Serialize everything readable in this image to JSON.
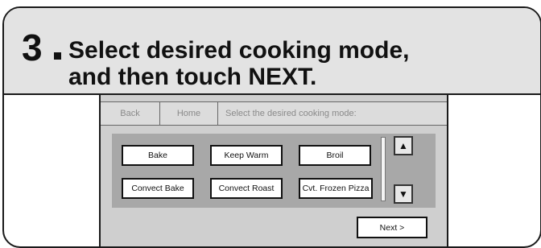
{
  "instruction": {
    "step_number": "3",
    "line1": "Select desired cooking mode,",
    "line2": "and then touch NEXT."
  },
  "screen": {
    "nav": {
      "back_label": "Back",
      "home_label": "Home"
    },
    "prompt": "Select the desired cooking mode:",
    "modes": [
      "Bake",
      "Keep Warm",
      "Broil",
      "Convect Bake",
      "Convect Roast",
      "Cvt. Frozen Pizza"
    ],
    "scroll_up_icon": "▲",
    "scroll_down_icon": "▼",
    "next_label": "Next >"
  }
}
